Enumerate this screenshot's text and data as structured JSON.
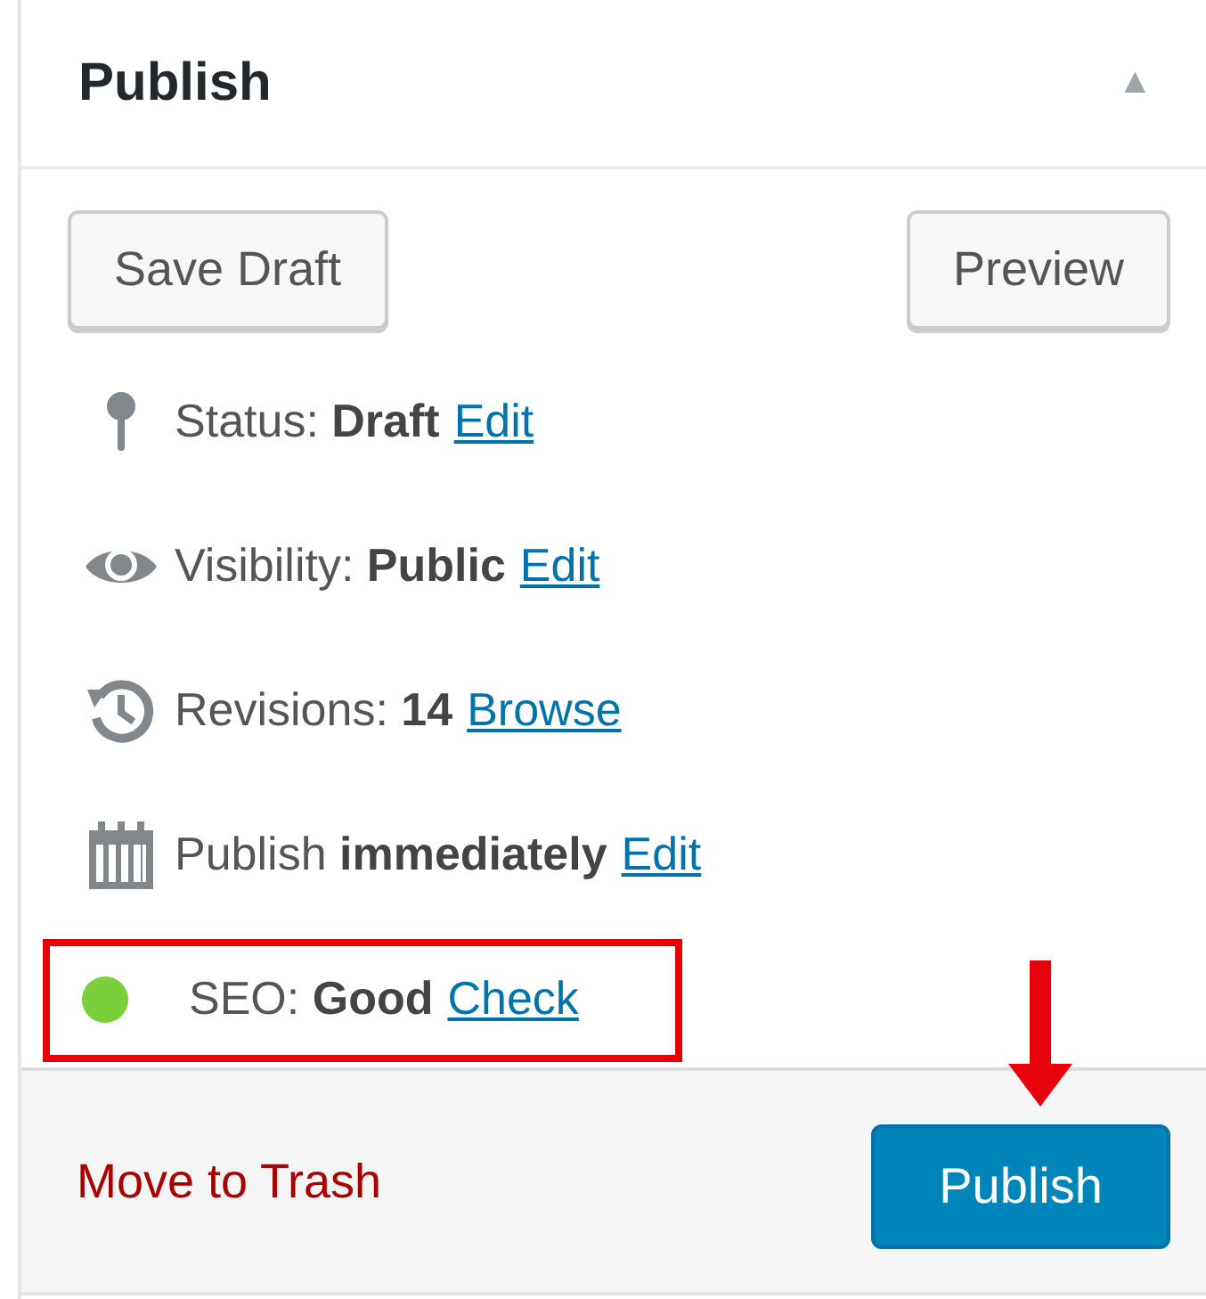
{
  "title": "Publish",
  "collapse_icon": "▲",
  "buttons": [
    {
      "label": "Save Draft"
    },
    {
      "label": "Preview"
    }
  ],
  "rows": [
    {
      "kind": "pin",
      "text": "Status: **Draft**",
      "link": "Edit",
      "highlighted": false
    },
    {
      "kind": "eye",
      "text": "Visibility: **Public**",
      "link": "Edit",
      "highlighted": false
    },
    {
      "kind": "history",
      "text": "Revisions: **14**",
      "link": "Browse",
      "highlighted": false
    },
    {
      "kind": "calendar",
      "text": "Publish **immediately**",
      "link": "Edit",
      "highlighted": false
    },
    {
      "kind": "dot",
      "color": "#7ad03a",
      "text": "SEO: **Good**",
      "link": "Check",
      "highlighted": true
    }
  ],
  "trash_link": "Move to Trash",
  "publish_button": {
    "label": "Publish",
    "pointed": true
  }
}
